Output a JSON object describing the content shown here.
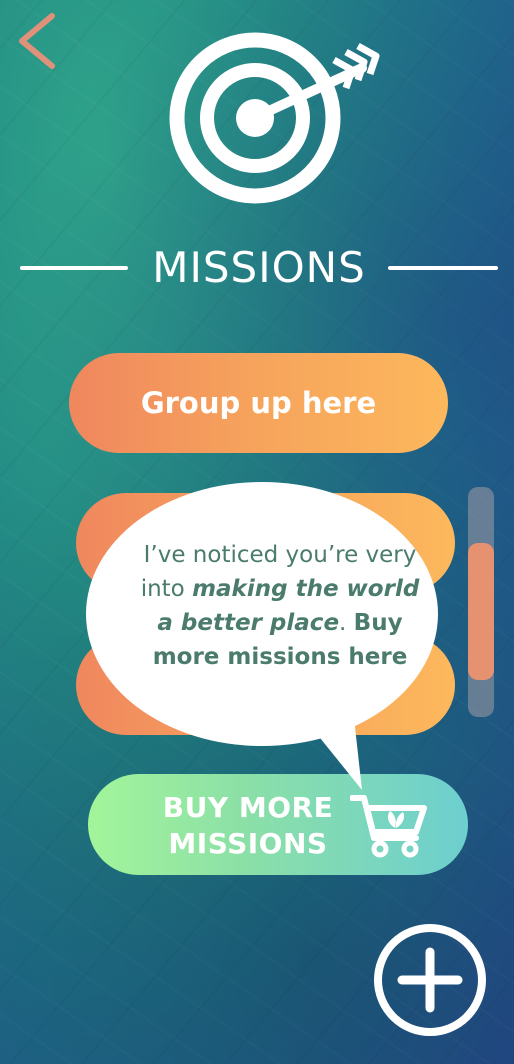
{
  "header": {
    "title": "MISSIONS"
  },
  "missions": {
    "buttons": [
      {
        "label": "Group up here"
      }
    ]
  },
  "scrollbar": {
    "position_fraction": 0.6
  },
  "tooltip": {
    "line_plain_1": "I’ve noticed you’re very into ",
    "line_italic": "making the world a better place",
    "line_plain_2": ". ",
    "line_bold": "Buy more missions here"
  },
  "buy": {
    "label_line1": "BUY MORE",
    "label_line2": "MISSIONS"
  },
  "icons": {
    "back": "chevron-left-icon",
    "target": "target-arrow-icon",
    "cart": "shopping-cart-leaf-icon",
    "add": "plus-circle-icon"
  },
  "colors": {
    "accent_orange": "#f6a45c",
    "back_arrow": "#e0917a",
    "buy_green": "#a3f59a",
    "buy_teal": "#6dcfcf",
    "tooltip_text": "#4a7b6c"
  }
}
